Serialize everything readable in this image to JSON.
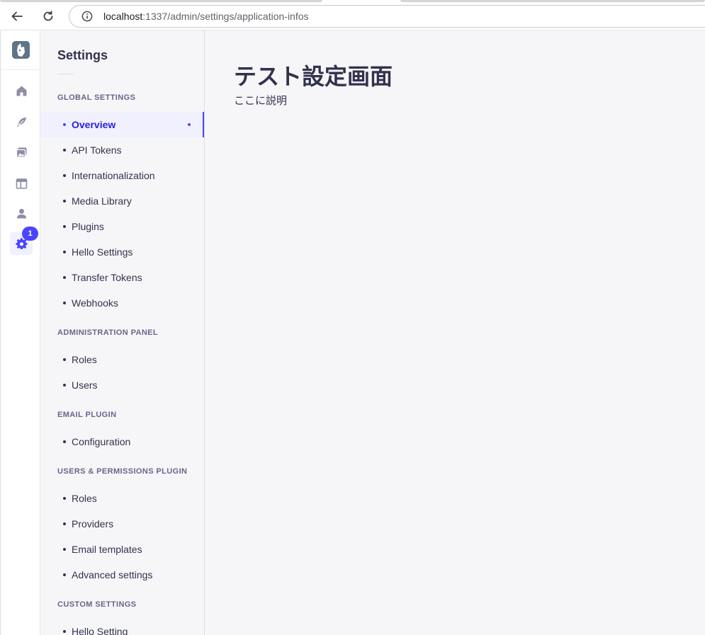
{
  "browser": {
    "url_host": "localhost",
    "url_path": ":1337/admin/settings/application-infos"
  },
  "rail": {
    "items": [
      {
        "icon": "home-icon"
      },
      {
        "icon": "feather-icon"
      },
      {
        "icon": "images-icon"
      },
      {
        "icon": "layout-icon"
      },
      {
        "icon": "user-icon"
      },
      {
        "icon": "gear-icon"
      }
    ],
    "settings_badge": "1"
  },
  "subnav": {
    "title": "Settings",
    "sections": [
      {
        "label": "GLOBAL SETTINGS",
        "links": [
          "Overview",
          "API Tokens",
          "Internationalization",
          "Media Library",
          "Plugins",
          "Hello Settings",
          "Transfer Tokens",
          "Webhooks"
        ]
      },
      {
        "label": "ADMINISTRATION PANEL",
        "links": [
          "Roles",
          "Users"
        ]
      },
      {
        "label": "EMAIL PLUGIN",
        "links": [
          "Configuration"
        ]
      },
      {
        "label": "USERS & PERMISSIONS PLUGIN",
        "links": [
          "Roles",
          "Providers",
          "Email templates",
          "Advanced settings"
        ]
      },
      {
        "label": "CUSTOM SETTINGS",
        "links": [
          "Hello Setting"
        ]
      }
    ],
    "active_link": "Overview"
  },
  "content": {
    "title": "テスト設定画面",
    "description": "ここに説明"
  },
  "colors": {
    "primary": "#4945ff",
    "active_text": "#271fe0",
    "neutral_text": "#32324d",
    "section_label": "#666687",
    "background": "#f6f6f9"
  }
}
